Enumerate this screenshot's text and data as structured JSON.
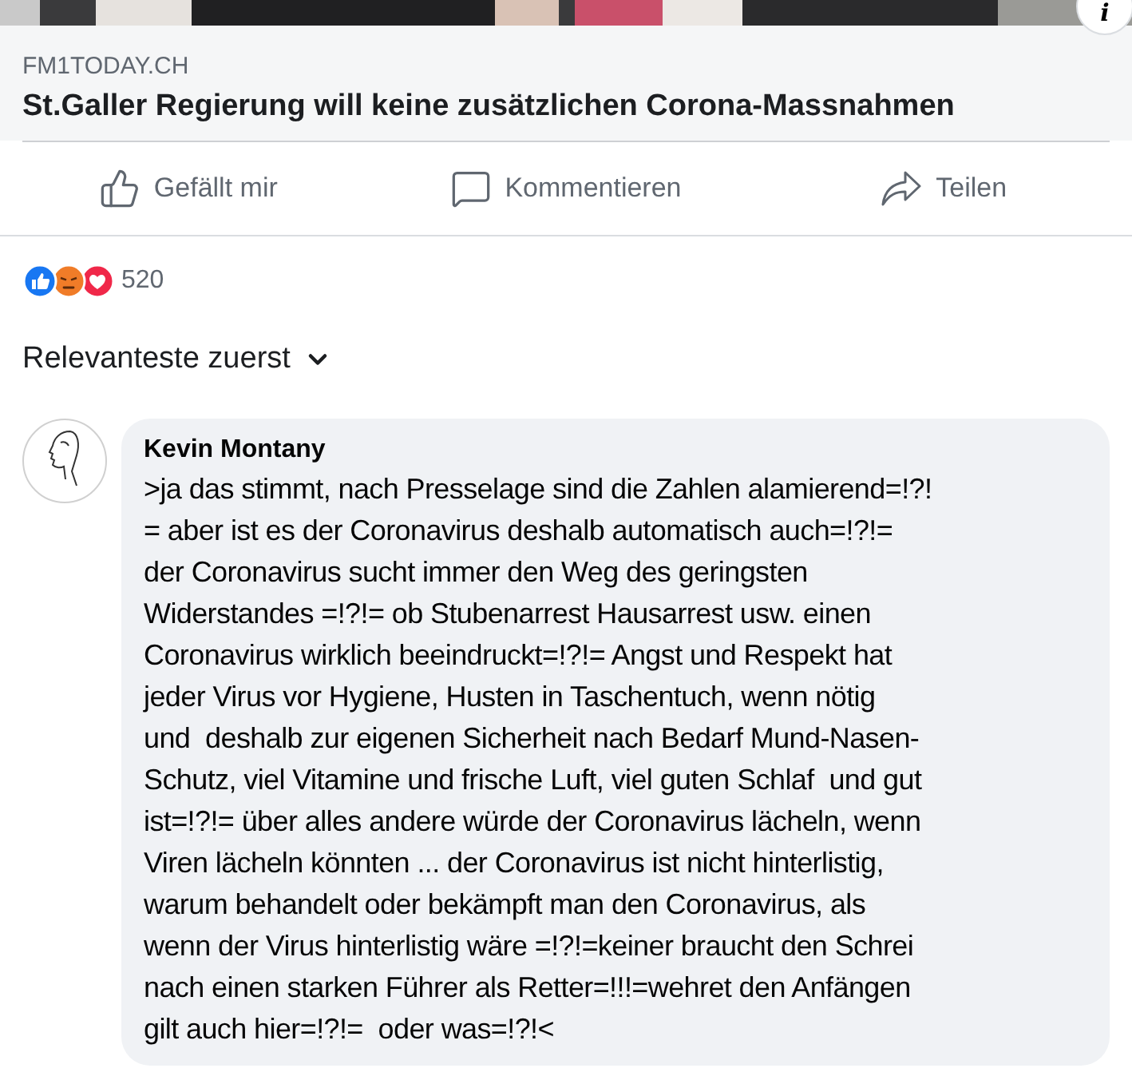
{
  "link_preview": {
    "info_button": "i",
    "domain": "FM1TODAY.CH",
    "title": "St.Galler Regierung will keine zusätzlichen Corona-Massnahmen"
  },
  "actions": [
    {
      "kind": "like",
      "label": "Gefällt mir"
    },
    {
      "kind": "comment",
      "label": "Kommentieren"
    },
    {
      "kind": "share",
      "label": "Teilen"
    }
  ],
  "reactions": {
    "types": [
      {
        "kind": "like"
      },
      {
        "kind": "angry"
      },
      {
        "kind": "love"
      }
    ],
    "count": "520"
  },
  "sort": {
    "label": "Relevanteste zuerst"
  },
  "comments": [
    {
      "author": "Kevin Montany",
      "text": ">ja das stimmt, nach Presselage sind die Zahlen alamierend=!?!\n= aber ist es der Coronavirus deshalb automatisch auch=!?!=\nder Coronavirus sucht immer den Weg des geringsten\nWiderstandes =!?!= ob Stubenarrest Hausarrest usw. einen\nCoronavirus wirklich beeindruckt=!?!= Angst und Respekt hat\njeder Virus vor Hygiene, Husten in Taschentuch, wenn nötig\nund  deshalb zur eigenen Sicherheit nach Bedarf Mund-Nasen-\nSchutz, viel Vitamine und frische Luft, viel guten Schlaf  und gut\nist=!?!= über alles andere würde der Coronavirus lächeln, wenn\nViren lächeln könnten ... der Coronavirus ist nicht hinterlistig,\nwarum behandelt oder bekämpft man den Coronavirus, als\nwenn der Virus hinterlistig wäre =!?!=keiner braucht den Schrei\nnach einen starken Führer als Retter=!!!=wehret den Anfängen\ngilt auch hier=!?!=  oder was=!?!<"
    }
  ]
}
